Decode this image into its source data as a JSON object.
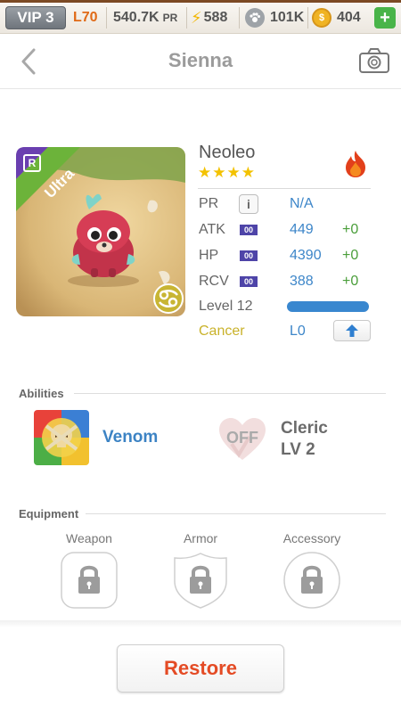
{
  "status_bar": {
    "vip": "VIP 3",
    "level": "L70",
    "pr_value": "540.7K",
    "pr_unit": "PR",
    "energy": "588",
    "paws": "101K",
    "coins": "404",
    "add_label": "+"
  },
  "header": {
    "title": "Sienna"
  },
  "pet": {
    "rarity_label": "Ultra",
    "rank_badge": "R",
    "name": "Neoleo",
    "stars": "★★★★",
    "star_count": 4,
    "stats": {
      "pr_label": "PR",
      "pr_value": "N/A",
      "atk_label": "ATK",
      "atk_level": "00",
      "atk_value": "449",
      "atk_bonus": "+0",
      "hp_label": "HP",
      "hp_level": "00",
      "hp_value": "4390",
      "hp_bonus": "+0",
      "rcv_label": "RCV",
      "rcv_level": "00",
      "rcv_value": "388",
      "rcv_bonus": "+0"
    },
    "level": "Level 12",
    "level_progress": 1.0,
    "zodiac": "Cancer",
    "zodiac_level": "L0"
  },
  "abilities": {
    "title": "Abilities",
    "items": [
      {
        "name": "Venom"
      },
      {
        "status": "OFF",
        "name": "Cleric",
        "level": "LV 2"
      }
    ]
  },
  "equipment": {
    "title": "Equipment",
    "slots": [
      "Weapon",
      "Armor",
      "Accessory"
    ]
  },
  "restore_label": "Restore",
  "colors": {
    "accent_blue": "#3d86c9",
    "bonus_green": "#4a9e3a",
    "restore_red": "#e44b25",
    "ultra_green": "#6cb33a",
    "rank_purple": "#6a3fb0",
    "zodiac_gold": "#c9b22a"
  }
}
